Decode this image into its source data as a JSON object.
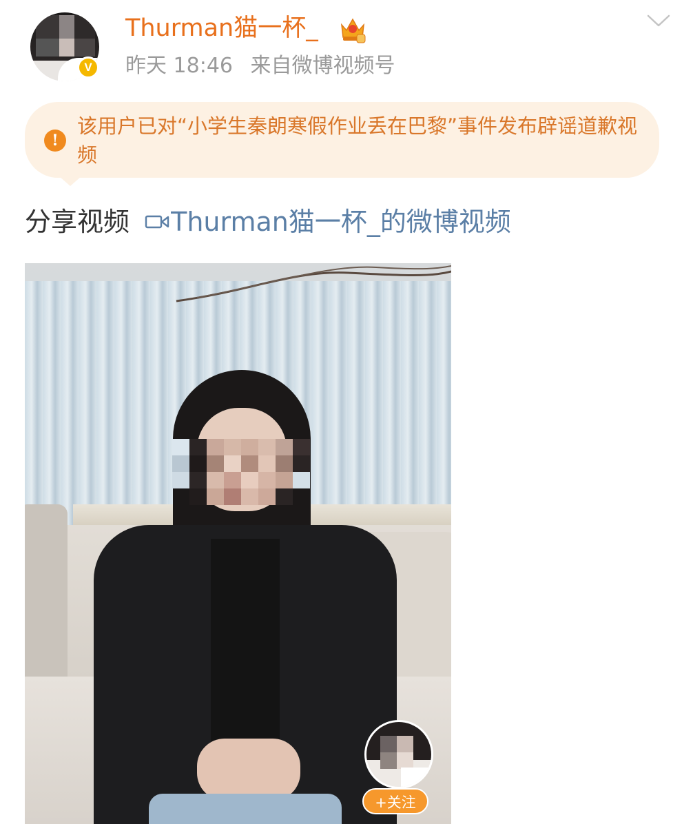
{
  "post": {
    "username": "Thurman猫一杯_",
    "time": "昨天 18:46",
    "source": "来自微博视频号",
    "verified_badge": "V",
    "notice": "该用户已对“小学生秦朗寒假作业丢在巴黎”事件发布辟谣道歉视频",
    "share_prefix": "分享视频",
    "share_link": "Thurman猫一杯_的微博视频",
    "follow_label": "+关注"
  },
  "colors": {
    "username": "#e8701c",
    "notice_bg": "#fdf1e3",
    "notice_text": "#d9772a",
    "link": "#5b7fa6",
    "follow_button": "#f6982c"
  },
  "icons": {
    "crown": "crown-icon",
    "chevron": "chevron-down-icon",
    "info": "info-icon",
    "camera": "video-camera-icon",
    "verified": "verified-icon"
  }
}
